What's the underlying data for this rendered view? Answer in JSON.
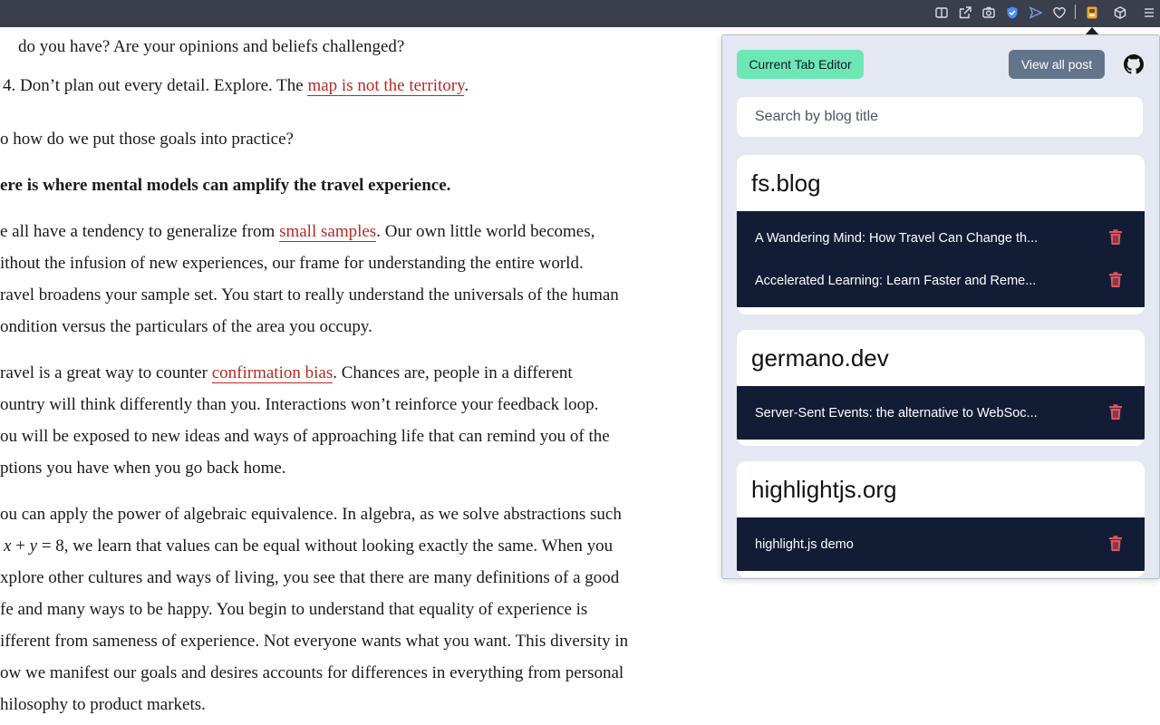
{
  "toolbar": {
    "icons": [
      "reader-view-icon",
      "share-icon",
      "screenshot-icon",
      "shield-icon",
      "send-icon",
      "heart-icon",
      "extension-icon",
      "cube-icon",
      "menu-icon"
    ]
  },
  "article": {
    "l1": "do you have? Are your opinions and beliefs challenged?",
    "l2a": "4. Don’t plan out every detail. Explore. The ",
    "l2link": "map is not the territory",
    "l2b": ".",
    "l3": "o how do we put those goals into practice?",
    "l4": "ere is where mental models can amplify the travel experience.",
    "l5a": "e all have a tendency to generalize from ",
    "l5link": "small samples",
    "l5b": ". Our own little world becomes,",
    "l6": "ithout the infusion of new experiences, our frame for understanding the entire world.",
    "l7": "ravel broadens your sample set. You start to really understand the universals of the human",
    "l8": "ondition versus the particulars of the area you occupy.",
    "l9a": "ravel is a great way to counter ",
    "l9link": "confirmation bias",
    "l9b": ". Chances are, people in a different",
    "l10": "ountry will think differently than you. Interactions won’t reinforce your feedback loop.",
    "l11": "ou will be exposed to new ideas and ways of approaching life that can remind you of the",
    "l12": "ptions you have when you go back home.",
    "l13": "ou can apply the power of algebraic equivalence. In algebra, as we solve abstractions such",
    "l14x": "x",
    "l14plus": " + ",
    "l14y": "y",
    "l14b": " = 8, we learn that values can be equal without looking exactly the same. When you",
    "l15": "xplore other cultures and ways of living, you see that there are many definitions of a good",
    "l16": "fe and many ways to be happy. You begin to understand that equality of experience is",
    "l17": "ifferent from sameness of experience. Not everyone wants what you want. This diversity in",
    "l18": "ow we manifest our goals and desires accounts for differences in everything from personal",
    "l19": "hilosophy to product markets."
  },
  "popup": {
    "editor_button": "Current Tab Editor",
    "view_all_button": "View all post",
    "github_icon": "github-icon",
    "search_placeholder": "Search by blog title",
    "groups": [
      {
        "site": "fs.blog",
        "posts": [
          "A Wandering Mind: How Travel Can Change th...",
          "Accelerated Learning: Learn Faster and Reme..."
        ]
      },
      {
        "site": "germano.dev",
        "posts": [
          "Server-Sent Events: the alternative to WebSoc..."
        ]
      },
      {
        "site": "highlightjs.org",
        "posts": [
          "highlight.js demo"
        ]
      }
    ]
  },
  "colors": {
    "toolbar_bg": "#3a3f4b",
    "link": "#b82a24",
    "editor_button": "#6ee7b7",
    "view_all_button": "#64748b",
    "card_body": "#131c35",
    "trash": "#e0555f"
  }
}
